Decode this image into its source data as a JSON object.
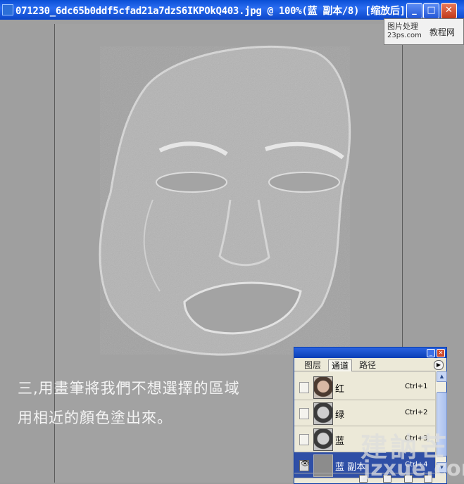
{
  "window": {
    "title": "071230_6dc65b0ddf5cfad21a7dzS6IKPOkQ403.jpg @ 100%(蓝 副本/8) [缩放后]",
    "minimize_glyph": "_",
    "maximize_glyph": "□",
    "close_glyph": "✕"
  },
  "watermark_corner": {
    "line1": "图片处理",
    "line2": "23ps.com",
    "line3": "教程网"
  },
  "captions": {
    "line1": "三,用畫筆將我們不想選擇的區域",
    "line2": "用相近的顏色塗出來。"
  },
  "channels_panel": {
    "tabs": [
      {
        "label": "图层",
        "active": false
      },
      {
        "label": "通道",
        "active": true
      },
      {
        "label": "路径",
        "active": false
      }
    ],
    "menu_glyph": "▶",
    "channels": [
      {
        "name": "红",
        "shortcut": "Ctrl+1",
        "visible": false,
        "selected": false
      },
      {
        "name": "绿",
        "shortcut": "Ctrl+2",
        "visible": false,
        "selected": false
      },
      {
        "name": "蓝",
        "shortcut": "Ctrl+3",
        "visible": false,
        "selected": false
      },
      {
        "name": "蓝 副本",
        "shortcut": "Ctrl+4",
        "visible": true,
        "selected": true
      }
    ]
  },
  "big_watermark": {
    "line1": "建訥芒",
    "line2": "jzxue.com"
  },
  "icons": [
    "app-icon",
    "eye-icon",
    "panel-menu-icon",
    "scroll-up-icon",
    "scroll-down-icon"
  ]
}
